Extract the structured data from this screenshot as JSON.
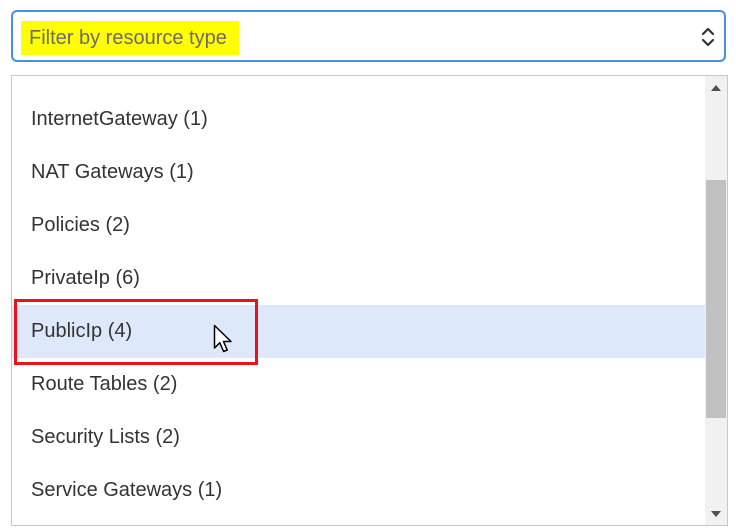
{
  "filter": {
    "placeholder": "Filter by resource type",
    "highlight_color": "#ffff00"
  },
  "dropdown": {
    "items": [
      {
        "label": "InternetGateway (1)"
      },
      {
        "label": "NAT Gateways (1)"
      },
      {
        "label": "Policies (2)"
      },
      {
        "label": "PrivateIp (6)"
      },
      {
        "label": "PublicIp (4)",
        "state": "hovered"
      },
      {
        "label": "Route Tables (2)"
      },
      {
        "label": "Security Lists (2)"
      },
      {
        "label": "Service Gateways (1)"
      }
    ],
    "hover_color": "#dde9fb"
  },
  "annotation": {
    "box_color": "#e8141b"
  },
  "icons": {
    "select_toggle": "chevron-up-down-icon",
    "scroll_up": "scroll-up-arrow-icon",
    "scroll_down": "scroll-down-arrow-icon",
    "pointer": "mouse-pointer-icon"
  }
}
